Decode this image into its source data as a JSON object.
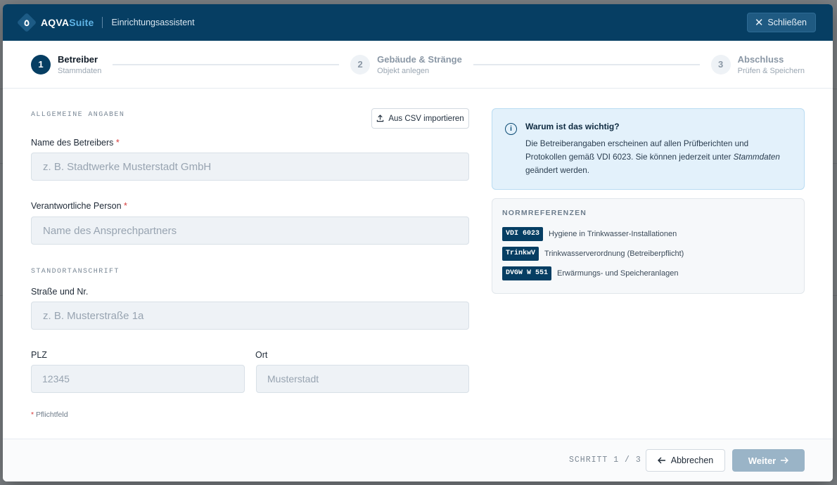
{
  "header": {
    "brand_part1": "AQVA",
    "brand_part2": "Suite",
    "subtitle": "Einrichtungsassistent",
    "close_label": "Schließen"
  },
  "stepper": {
    "steps": [
      {
        "number": "1",
        "title": "Betreiber",
        "subtitle": "Stammdaten",
        "state": "active"
      },
      {
        "number": "2",
        "title": "Gebäude & Stränge",
        "subtitle": "Objekt anlegen",
        "state": "pending"
      },
      {
        "number": "3",
        "title": "Abschluss",
        "subtitle": "Prüfen & Speichern",
        "state": "pending"
      }
    ]
  },
  "form": {
    "general_section": "ALLGEMEINE ANGABEN",
    "csv_import_label": "Aus CSV importieren",
    "operator_name": {
      "label": "Name des Betreibers",
      "required_mark": "*",
      "placeholder": "z. B. Stadtwerke Musterstadt GmbH",
      "value": ""
    },
    "responsible_person": {
      "label": "Verantwortliche Person",
      "required_mark": "*",
      "placeholder": "Name des Ansprechpartners",
      "value": ""
    },
    "address_section": "STANDORTANSCHRIFT",
    "street": {
      "label": "Straße und Nr.",
      "placeholder": "z. B. Musterstraße 1a",
      "value": ""
    },
    "zip": {
      "label": "PLZ",
      "placeholder": "12345",
      "value": ""
    },
    "city": {
      "label": "Ort",
      "placeholder": "Musterstadt",
      "value": ""
    },
    "required_note_mark": "*",
    "required_note": "Pflichtfeld"
  },
  "info": {
    "title": "Warum ist das wichtig?",
    "text_part1": "Die Betreiberangaben erscheinen auf allen Prüfberichten und Protokollen gemäß VDI 6023. Sie können jederzeit unter ",
    "text_emphasis": "Stammdaten",
    "text_part2": " geändert werden."
  },
  "norms": {
    "heading": "NORMREFERENZEN",
    "items": [
      {
        "tag": "VDI 6023",
        "description": "Hygiene in Trinkwasser-Installationen"
      },
      {
        "tag": "TrinkwV",
        "description": "Trinkwasserverordnung (Betreiberpflicht)"
      },
      {
        "tag": "DVGW W 551",
        "description": "Erwärmungs- und Speicheranlagen"
      }
    ]
  },
  "footer": {
    "step_indicator": "SCHRITT 1 / 3",
    "cancel_label": "Abbrechen",
    "next_label": "Weiter"
  },
  "colors": {
    "primary": "#063e63",
    "accent": "#5fb4e6",
    "required": "#d63b3b",
    "next_disabled": "#9ab4c7"
  }
}
